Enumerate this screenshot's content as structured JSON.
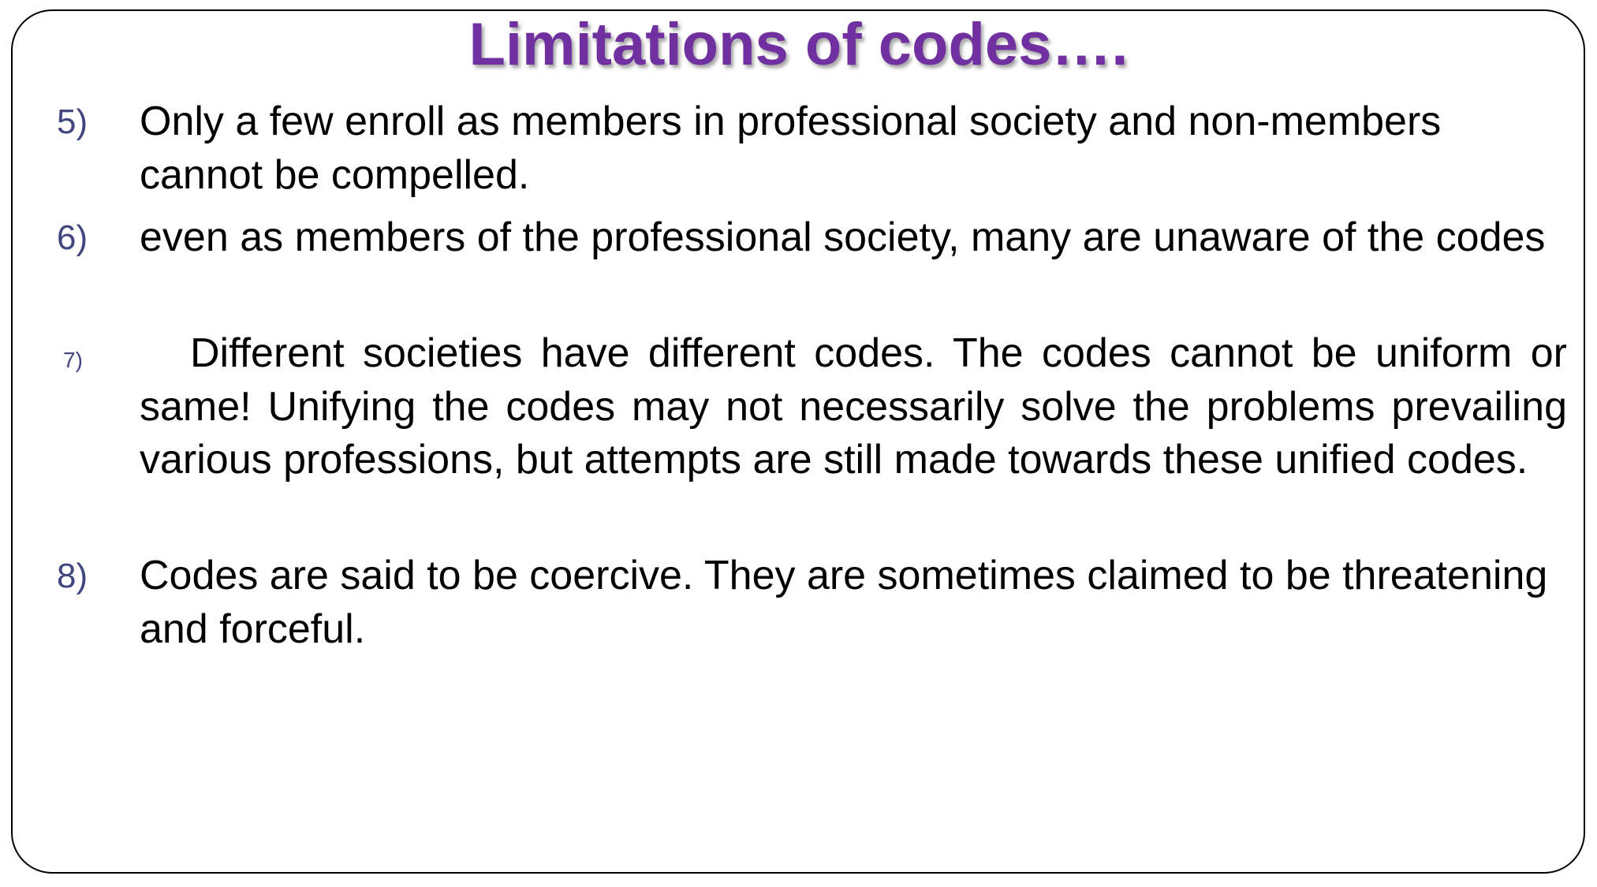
{
  "slide": {
    "title": "Limitations of codes….",
    "colors": {
      "title": "#7030a0",
      "number": "#414680",
      "text": "#000000",
      "border": "#000000"
    },
    "items": [
      {
        "number": "5)",
        "text": "Only a few enroll as members in professional society and non-members cannot be compelled."
      },
      {
        "number": "6)",
        "text": "even as members of the professional society, many are unaware of the codes"
      },
      {
        "number": "7)",
        "text": "Different societies have different codes. The codes cannot be uniform or  same! Unifying the codes may not necessarily solve the problems prevailing various professions, but attempts are still made towards these unified codes."
      },
      {
        "number": "8)",
        "text": "Codes are said to be coercive. They are sometimes claimed to be threatening and forceful."
      }
    ]
  }
}
